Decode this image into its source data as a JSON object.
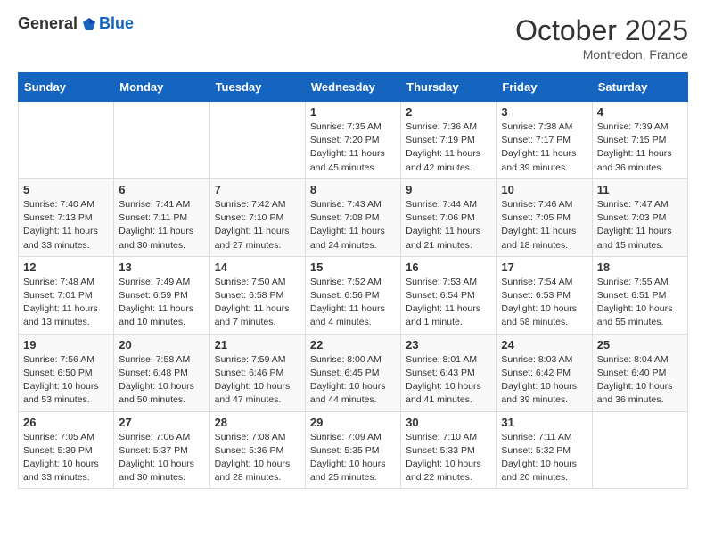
{
  "header": {
    "logo_general": "General",
    "logo_blue": "Blue",
    "month": "October 2025",
    "location": "Montredon, France"
  },
  "weekdays": [
    "Sunday",
    "Monday",
    "Tuesday",
    "Wednesday",
    "Thursday",
    "Friday",
    "Saturday"
  ],
  "rows": [
    [
      {
        "day": "",
        "info": ""
      },
      {
        "day": "",
        "info": ""
      },
      {
        "day": "",
        "info": ""
      },
      {
        "day": "1",
        "info": "Sunrise: 7:35 AM\nSunset: 7:20 PM\nDaylight: 11 hours\nand 45 minutes."
      },
      {
        "day": "2",
        "info": "Sunrise: 7:36 AM\nSunset: 7:19 PM\nDaylight: 11 hours\nand 42 minutes."
      },
      {
        "day": "3",
        "info": "Sunrise: 7:38 AM\nSunset: 7:17 PM\nDaylight: 11 hours\nand 39 minutes."
      },
      {
        "day": "4",
        "info": "Sunrise: 7:39 AM\nSunset: 7:15 PM\nDaylight: 11 hours\nand 36 minutes."
      }
    ],
    [
      {
        "day": "5",
        "info": "Sunrise: 7:40 AM\nSunset: 7:13 PM\nDaylight: 11 hours\nand 33 minutes."
      },
      {
        "day": "6",
        "info": "Sunrise: 7:41 AM\nSunset: 7:11 PM\nDaylight: 11 hours\nand 30 minutes."
      },
      {
        "day": "7",
        "info": "Sunrise: 7:42 AM\nSunset: 7:10 PM\nDaylight: 11 hours\nand 27 minutes."
      },
      {
        "day": "8",
        "info": "Sunrise: 7:43 AM\nSunset: 7:08 PM\nDaylight: 11 hours\nand 24 minutes."
      },
      {
        "day": "9",
        "info": "Sunrise: 7:44 AM\nSunset: 7:06 PM\nDaylight: 11 hours\nand 21 minutes."
      },
      {
        "day": "10",
        "info": "Sunrise: 7:46 AM\nSunset: 7:05 PM\nDaylight: 11 hours\nand 18 minutes."
      },
      {
        "day": "11",
        "info": "Sunrise: 7:47 AM\nSunset: 7:03 PM\nDaylight: 11 hours\nand 15 minutes."
      }
    ],
    [
      {
        "day": "12",
        "info": "Sunrise: 7:48 AM\nSunset: 7:01 PM\nDaylight: 11 hours\nand 13 minutes."
      },
      {
        "day": "13",
        "info": "Sunrise: 7:49 AM\nSunset: 6:59 PM\nDaylight: 11 hours\nand 10 minutes."
      },
      {
        "day": "14",
        "info": "Sunrise: 7:50 AM\nSunset: 6:58 PM\nDaylight: 11 hours\nand 7 minutes."
      },
      {
        "day": "15",
        "info": "Sunrise: 7:52 AM\nSunset: 6:56 PM\nDaylight: 11 hours\nand 4 minutes."
      },
      {
        "day": "16",
        "info": "Sunrise: 7:53 AM\nSunset: 6:54 PM\nDaylight: 11 hours\nand 1 minute."
      },
      {
        "day": "17",
        "info": "Sunrise: 7:54 AM\nSunset: 6:53 PM\nDaylight: 10 hours\nand 58 minutes."
      },
      {
        "day": "18",
        "info": "Sunrise: 7:55 AM\nSunset: 6:51 PM\nDaylight: 10 hours\nand 55 minutes."
      }
    ],
    [
      {
        "day": "19",
        "info": "Sunrise: 7:56 AM\nSunset: 6:50 PM\nDaylight: 10 hours\nand 53 minutes."
      },
      {
        "day": "20",
        "info": "Sunrise: 7:58 AM\nSunset: 6:48 PM\nDaylight: 10 hours\nand 50 minutes."
      },
      {
        "day": "21",
        "info": "Sunrise: 7:59 AM\nSunset: 6:46 PM\nDaylight: 10 hours\nand 47 minutes."
      },
      {
        "day": "22",
        "info": "Sunrise: 8:00 AM\nSunset: 6:45 PM\nDaylight: 10 hours\nand 44 minutes."
      },
      {
        "day": "23",
        "info": "Sunrise: 8:01 AM\nSunset: 6:43 PM\nDaylight: 10 hours\nand 41 minutes."
      },
      {
        "day": "24",
        "info": "Sunrise: 8:03 AM\nSunset: 6:42 PM\nDaylight: 10 hours\nand 39 minutes."
      },
      {
        "day": "25",
        "info": "Sunrise: 8:04 AM\nSunset: 6:40 PM\nDaylight: 10 hours\nand 36 minutes."
      }
    ],
    [
      {
        "day": "26",
        "info": "Sunrise: 7:05 AM\nSunset: 5:39 PM\nDaylight: 10 hours\nand 33 minutes."
      },
      {
        "day": "27",
        "info": "Sunrise: 7:06 AM\nSunset: 5:37 PM\nDaylight: 10 hours\nand 30 minutes."
      },
      {
        "day": "28",
        "info": "Sunrise: 7:08 AM\nSunset: 5:36 PM\nDaylight: 10 hours\nand 28 minutes."
      },
      {
        "day": "29",
        "info": "Sunrise: 7:09 AM\nSunset: 5:35 PM\nDaylight: 10 hours\nand 25 minutes."
      },
      {
        "day": "30",
        "info": "Sunrise: 7:10 AM\nSunset: 5:33 PM\nDaylight: 10 hours\nand 22 minutes."
      },
      {
        "day": "31",
        "info": "Sunrise: 7:11 AM\nSunset: 5:32 PM\nDaylight: 10 hours\nand 20 minutes."
      },
      {
        "day": "",
        "info": ""
      }
    ]
  ]
}
